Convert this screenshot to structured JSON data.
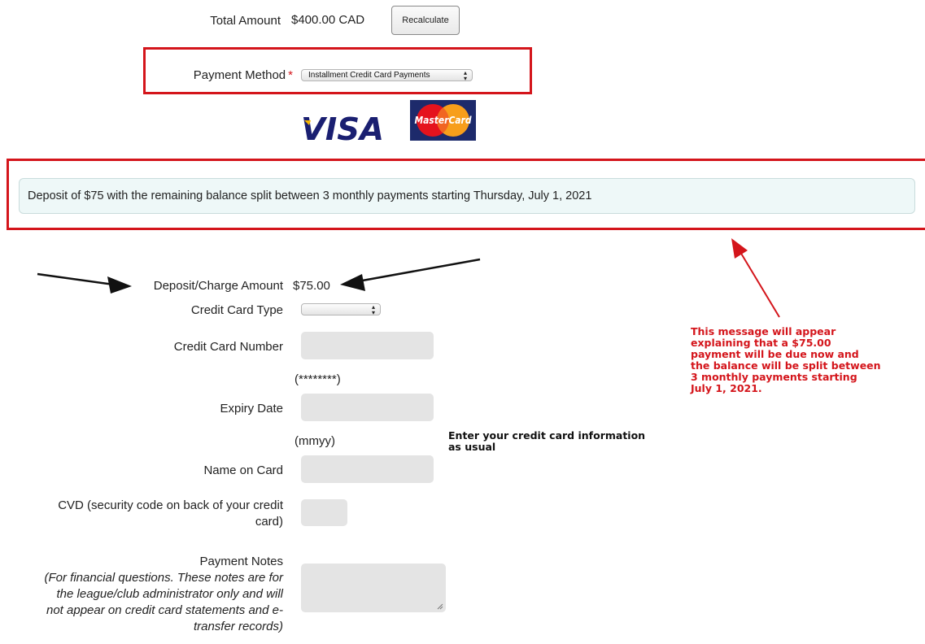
{
  "total": {
    "label": "Total Amount",
    "value": "$400.00 CAD",
    "recalc_label": "Recalculate"
  },
  "payment_method": {
    "label": "Payment Method",
    "required_mark": "*",
    "selected": "Installment Credit Card Payments"
  },
  "card_logos": {
    "visa": "VISA",
    "mastercard": "MasterCard"
  },
  "installment_message": "Deposit of $75 with the remaining balance split between 3 monthly payments starting Thursday, July 1, 2021",
  "deposit": {
    "label": "Deposit/Charge Amount",
    "value": "$75.00"
  },
  "form": {
    "card_type_label": "Credit Card Type",
    "card_type_selected": "",
    "card_number_label": "Credit Card Number",
    "card_number_hint": "(********)",
    "expiry_label": "Expiry Date",
    "expiry_hint": "(mmyy)",
    "name_label": "Name on Card",
    "cvd_label_line1": "CVD (security code on back of your credit",
    "cvd_label_line2": "card)",
    "notes_label": "Payment Notes",
    "notes_help": [
      "(For financial questions. These notes are for",
      "the league/club administrator only and will",
      "not appear on credit card statements and e-",
      "transfer records)"
    ]
  },
  "annotations": {
    "red_note": [
      "This message will appear",
      "explaining that a $75.00",
      "payment will be due now and",
      "the balance will be split between",
      "3 monthly payments starting",
      "July 1, 2021."
    ],
    "black_note": [
      "Enter your credit card information",
      "as usual"
    ]
  },
  "colors": {
    "highlight_red": "#d4151b",
    "message_bg": "#eef8f8",
    "field_bg": "#e4e4e4",
    "visa_blue": "#1a1f71",
    "visa_gold": "#f7b600"
  }
}
